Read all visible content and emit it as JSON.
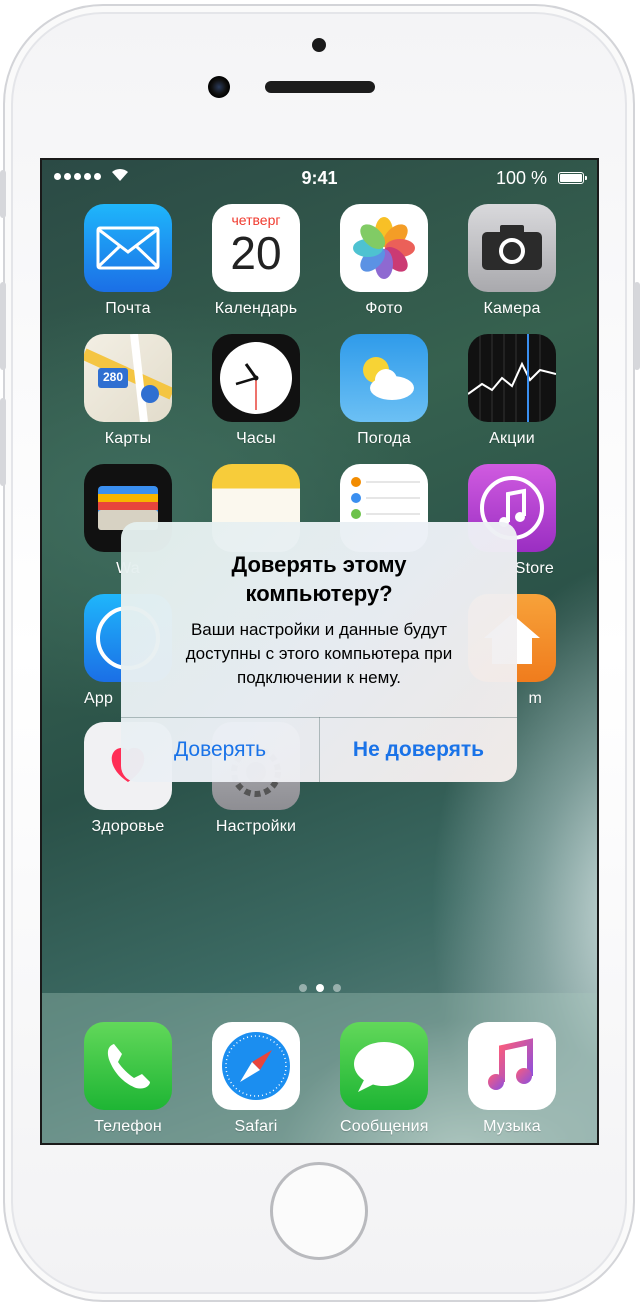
{
  "status_bar": {
    "time": "9:41",
    "battery": "100 %"
  },
  "apps": [
    {
      "id": "mail",
      "label": "Почта",
      "icon": "mail-icon"
    },
    {
      "id": "calendar",
      "label": "Календарь",
      "icon": "calendar-icon",
      "weekday": "четверг",
      "day": "20"
    },
    {
      "id": "photos",
      "label": "Фото",
      "icon": "photos-icon"
    },
    {
      "id": "camera",
      "label": "Камера",
      "icon": "camera-icon"
    },
    {
      "id": "maps",
      "label": "Карты",
      "icon": "maps-icon",
      "road_sign": "280"
    },
    {
      "id": "clock",
      "label": "Часы",
      "icon": "clock-icon"
    },
    {
      "id": "weather",
      "label": "Погода",
      "icon": "weather-icon"
    },
    {
      "id": "stocks",
      "label": "Акции",
      "icon": "stocks-icon"
    },
    {
      "id": "wallet",
      "label": "Wa",
      "icon": "wallet-icon"
    },
    {
      "id": "notes",
      "label": "",
      "icon": "notes-icon"
    },
    {
      "id": "reminders",
      "label": "",
      "icon": "reminders-icon"
    },
    {
      "id": "itunes",
      "label": "Store",
      "icon": "itunes-store-icon"
    },
    {
      "id": "appstore",
      "label": "App",
      "icon": "app-store-icon"
    },
    {
      "id": "home",
      "label": "m",
      "icon": "home-icon"
    },
    {
      "id": "health",
      "label": "Здоровье",
      "icon": "health-icon"
    },
    {
      "id": "settings",
      "label": "Настройки",
      "icon": "settings-icon"
    }
  ],
  "dock": [
    {
      "id": "phone",
      "label": "Телефон",
      "icon": "phone-icon"
    },
    {
      "id": "safari",
      "label": "Safari",
      "icon": "safari-icon"
    },
    {
      "id": "messages",
      "label": "Сообщения",
      "icon": "messages-icon"
    },
    {
      "id": "music",
      "label": "Музыка",
      "icon": "music-icon"
    }
  ],
  "alert": {
    "title_line1": "Доверять этому",
    "title_line2": "компьютеру?",
    "message_line1": "Ваши настройки и данные будут",
    "message_line2": "доступны с этого компьютера при",
    "message_line3": "подключении к нему.",
    "trust_label": "Доверять",
    "dont_trust_label": "Не доверять"
  },
  "colors": {
    "alert_button": "#1a73e8"
  }
}
